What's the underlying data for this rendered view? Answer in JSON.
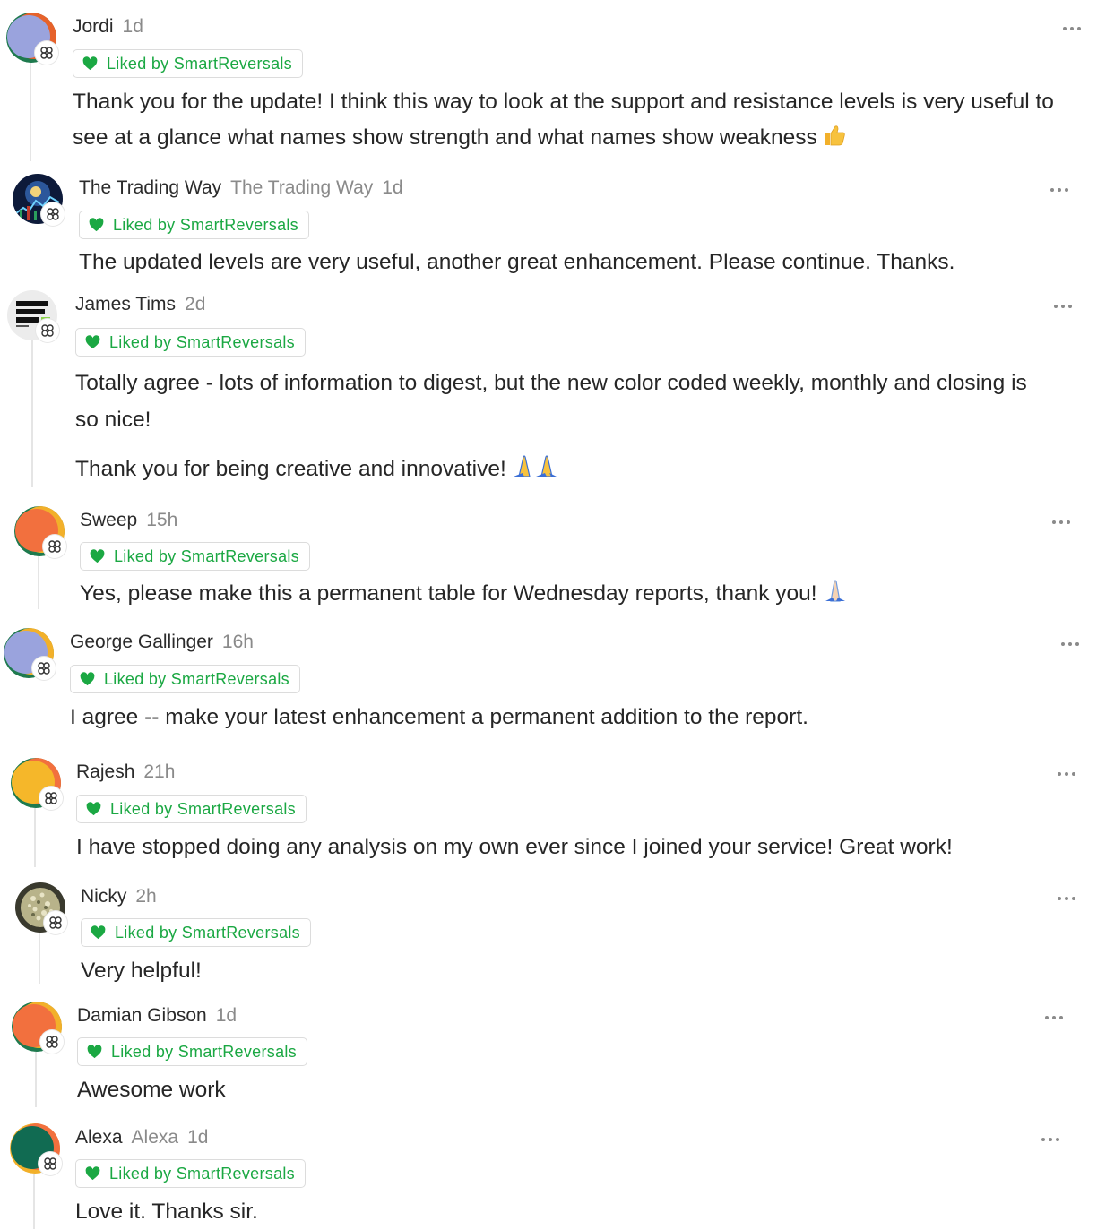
{
  "liked_label": "Liked by SmartReversals",
  "comments": [
    {
      "name": "Jordi",
      "display": "",
      "time": "1d",
      "text": [
        "Thank you for the update! I think this way to look at the support and resistance levels is very useful to see at a glance what names show strength and what names show weakness"
      ],
      "emoji": "thumbs-up"
    },
    {
      "name": "The Trading Way",
      "display": "The Trading Way",
      "time": "1d",
      "text": [
        "The updated levels are very useful, another great enhancement. Please continue. Thanks."
      ]
    },
    {
      "name": "James Tims",
      "display": "",
      "time": "2d",
      "text": [
        "Totally agree - lots of information to digest, but the new color coded weekly, monthly and closing is so nice!",
        "Thank you for being creative and innovative!"
      ],
      "emoji": "praying-hands"
    },
    {
      "name": "Sweep",
      "display": "",
      "time": "15h",
      "text": [
        "Yes, please make this a permanent table for Wednesday reports, thank you!"
      ],
      "emoji": "praying-hands-light"
    },
    {
      "name": "George Gallinger",
      "display": "",
      "time": "16h",
      "text": [
        "I agree -- make your latest enhancement a permanent addition to the report."
      ]
    },
    {
      "name": "Rajesh",
      "display": "",
      "time": "21h",
      "text": [
        "I have stopped doing any analysis on my own ever since I joined your service! Great work!"
      ]
    },
    {
      "name": "Nicky",
      "display": "",
      "time": "2h",
      "text": [
        "Very helpful!"
      ]
    },
    {
      "name": "Damian Gibson",
      "display": "",
      "time": "1d",
      "text": [
        "Awesome work"
      ]
    },
    {
      "name": "Alexa",
      "display": "Alexa",
      "time": "1d",
      "text": [
        "Love it. Thanks sir."
      ]
    }
  ],
  "colors": {
    "liked_green": "#1ba843",
    "thread_line": "#e5e5e5",
    "muted_text": "#8a8a8a"
  },
  "avatar_icons": [
    "avatar-periwinkle",
    "avatar-trading-chart",
    "avatar-act-justly-poster",
    "avatar-orange",
    "avatar-periwinkle",
    "avatar-yellow",
    "avatar-texture-photo",
    "avatar-orange",
    "avatar-green"
  ]
}
